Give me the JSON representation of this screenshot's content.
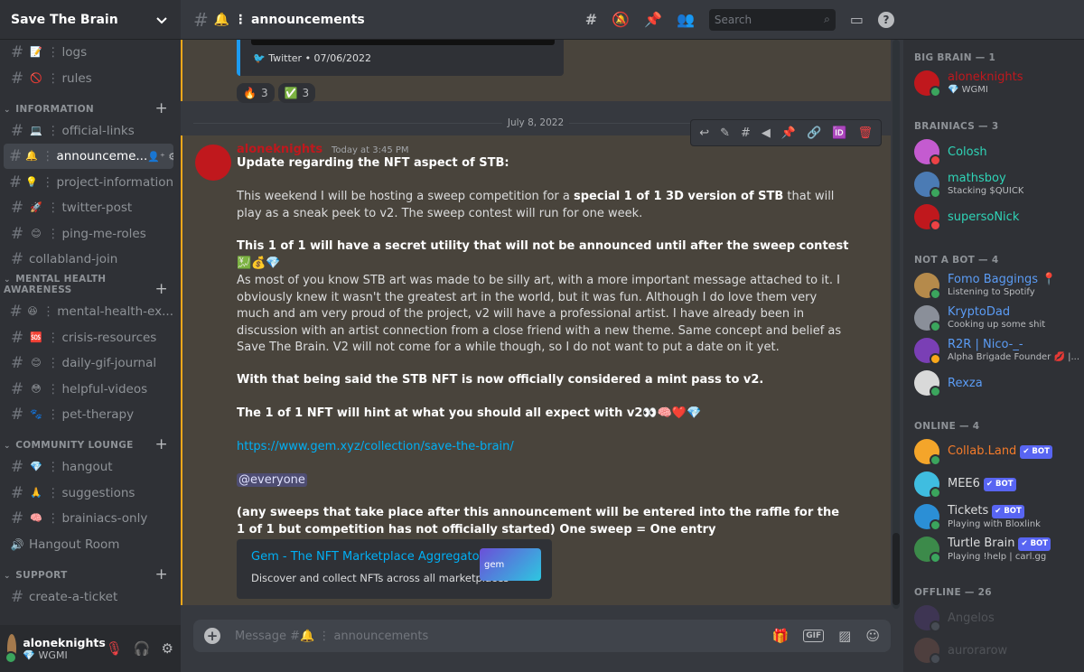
{
  "server": {
    "name": "Save The Brain"
  },
  "sidebar": {
    "top_channels": [
      {
        "name": "logs",
        "emoji": "📝"
      },
      {
        "name": "rules",
        "emoji": "🚫"
      }
    ],
    "categories": [
      {
        "name": "INFORMATION",
        "channels": [
          {
            "name": "official-links",
            "emoji": "💻"
          },
          {
            "name": "announceme...",
            "emoji": "🔔"
          },
          {
            "name": "project-information",
            "emoji": "💡"
          },
          {
            "name": "twitter-post",
            "emoji": "🚀"
          },
          {
            "name": "ping-me-roles",
            "emoji": "😊"
          },
          {
            "name": "collabland-join",
            "emoji": ""
          }
        ]
      },
      {
        "name": "MENTAL HEALTH AWARENESS",
        "channels": [
          {
            "name": "mental-health-ex...",
            "emoji": "😆"
          },
          {
            "name": "crisis-resources",
            "emoji": "🆘"
          },
          {
            "name": "daily-gif-journal",
            "emoji": "😊"
          },
          {
            "name": "helpful-videos",
            "emoji": "😳"
          },
          {
            "name": "pet-therapy",
            "emoji": "🐾"
          }
        ]
      },
      {
        "name": "COMMUNITY LOUNGE",
        "channels": [
          {
            "name": "hangout",
            "emoji": "💎"
          },
          {
            "name": "suggestions",
            "emoji": "🙏"
          },
          {
            "name": "brainiacs-only",
            "emoji": "🧠"
          },
          {
            "name": "Hangout Room",
            "emoji": ""
          }
        ]
      },
      {
        "name": "SUPPORT",
        "channels": [
          {
            "name": "create-a-ticket",
            "emoji": ""
          }
        ]
      }
    ]
  },
  "user": {
    "name": "aloneknights",
    "status": "💎 WGMI"
  },
  "channel": {
    "name": "🔔 ⋮ announcements",
    "search_placeholder": "Search"
  },
  "prev_message": {
    "embed_footer": "Twitter • 07/06/2022",
    "reactions": [
      {
        "emoji": "🔥",
        "count": "3"
      },
      {
        "emoji": "✅",
        "count": "3"
      }
    ]
  },
  "date_divider": "July 8, 2022",
  "message": {
    "author": "aloneknights",
    "timestamp": "Today at 3:45 PM",
    "line1": "Update regarding the NFT aspect of STB:",
    "p1_a": "This weekend I will be hosting a sweep competition for a ",
    "p1_b": "special 1 of 1 3D version of STB",
    "p1_c": " that will play as a sneak peek to v2. The sweep contest will run for one week.",
    "p2": "This 1 of 1 will have a secret utility that will not be announced until after the sweep contest 💹💰💎",
    "p3": "As most of you know STB art was made to be silly art, with a more important message attached to it. I obviously knew it wasn't the greatest art in the world, but it was fun. Although I do love them very much and am very proud of the project, v2 will have a professional artist. I have already been in discussion with an artist connection from a close friend with a new theme. Same concept and belief as Save The Brain. V2 will not come for a while though, so I do not want to put a date on it yet.",
    "p4": "With that being said the STB NFT is now officially considered a mint pass to v2.",
    "p5": "The 1 of 1 NFT will hint at what you should all expect with v2👀🧠❤️💎",
    "link": "https://www.gem.xyz/collection/save-the-brain/",
    "mention": "@everyone",
    "p6": "(any sweeps that take place after this announcement will be entered into the raffle for the 1 of 1 but competition has not officially started) One sweep = One entry",
    "embed_title": "Gem - The NFT Marketplace Aggregator",
    "embed_desc": "Discover and collect NFTs across all marketplaces",
    "embed_logo": "gem"
  },
  "composer": {
    "placeholder": "Message #🔔 ⋮ announcements",
    "gif": "GIF"
  },
  "members": {
    "groups": [
      {
        "label": "BIG BRAIN — 1",
        "items": [
          {
            "name": "aloneknights",
            "sub": "💎 WGMI",
            "color": "#c0181d",
            "avatar": "#c0181d",
            "status": "#3ba55d"
          }
        ]
      },
      {
        "label": "BRAINIACS — 3",
        "items": [
          {
            "name": "Colosh",
            "sub": "",
            "color": "#2fd4b7",
            "avatar": "#c45bd0",
            "status": "#ed4245"
          },
          {
            "name": "mathsboy",
            "sub": "Stacking $QUICK",
            "color": "#2fd4b7",
            "avatar": "#4b7bb4",
            "status": "#3ba55d"
          },
          {
            "name": "supersoNick",
            "sub": "",
            "color": "#2fd4b7",
            "avatar": "#c0181d",
            "status": "#ed4245"
          }
        ]
      },
      {
        "label": "NOT A BOT — 4",
        "items": [
          {
            "name": "Fomo Baggings 📍",
            "sub": "Listening to Spotify",
            "color": "#5b9cf5",
            "avatar": "#b58a4b",
            "status": "#3ba55d"
          },
          {
            "name": "KryptoDad",
            "sub": "Cooking up some shit",
            "color": "#5b9cf5",
            "avatar": "#8a8f99",
            "status": "#3ba55d"
          },
          {
            "name": "R2R | Nico-_-",
            "sub": "Alpha Brigade Founder 💋 |...",
            "color": "#5b9cf5",
            "avatar": "#7a3fb5",
            "status": "#faa81a"
          },
          {
            "name": "Rexza",
            "sub": "",
            "color": "#5b9cf5",
            "avatar": "#d9d9d9",
            "status": "#3ba55d"
          }
        ]
      },
      {
        "label": "ONLINE — 4",
        "items": [
          {
            "name": "Collab.Land",
            "sub": "",
            "color": "#f47b2a",
            "avatar": "#f4a52a",
            "status": "#3ba55d",
            "bot": "✔ BOT"
          },
          {
            "name": "MEE6",
            "sub": "",
            "color": "#dcddde",
            "avatar": "#3fbde0",
            "status": "#3ba55d",
            "bot": "✔ BOT"
          },
          {
            "name": "Tickets",
            "sub": "Playing with Bloxlink",
            "color": "#dcddde",
            "avatar": "#2b8fd6",
            "status": "#3ba55d",
            "bot": "✔ BOT"
          },
          {
            "name": "Turtle Brain",
            "sub": "Playing !help | carl.gg",
            "color": "#dcddde",
            "avatar": "#3c8a4a",
            "status": "#3ba55d",
            "bot": "✔ BOT"
          }
        ]
      },
      {
        "label": "OFFLINE — 26",
        "items": [
          {
            "name": "Angelos",
            "sub": "",
            "color": "#8e9297",
            "avatar": "#5a3f8a",
            "status": "#747f8d",
            "offline": true
          },
          {
            "name": "aurorarow",
            "sub": "",
            "color": "#8e9297",
            "avatar": "#8a5a4f",
            "status": "#747f8d",
            "offline": true
          }
        ]
      }
    ]
  }
}
